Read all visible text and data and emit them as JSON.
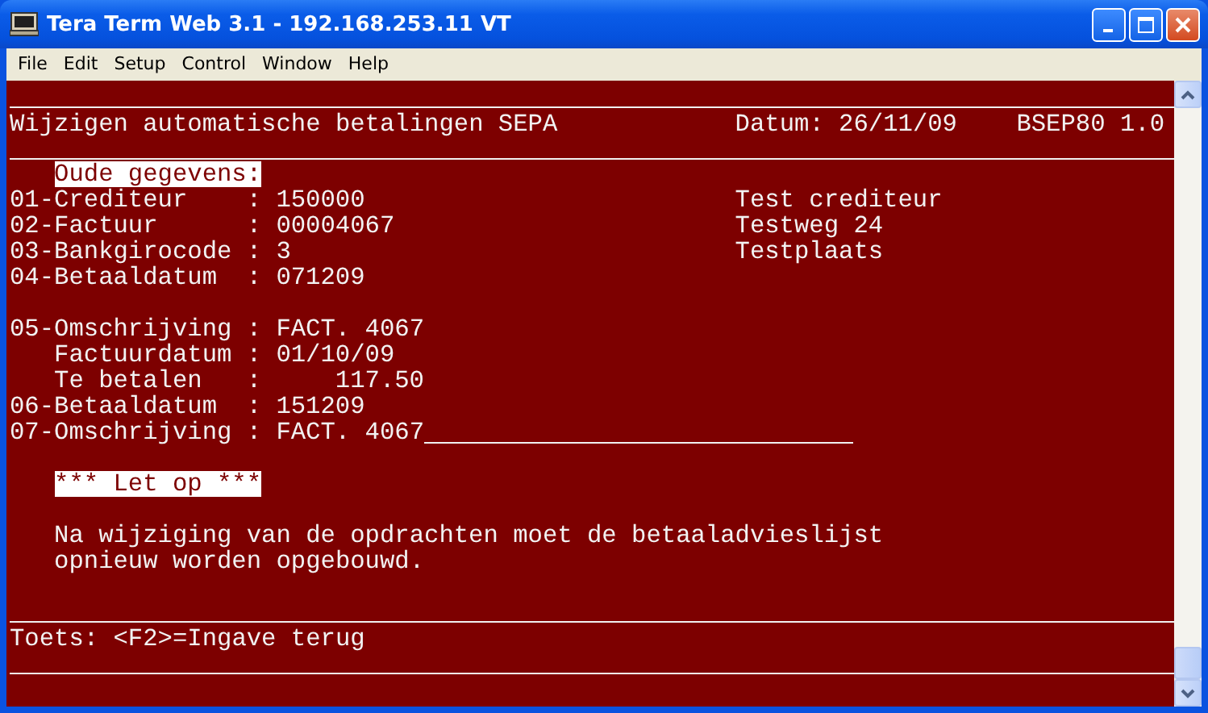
{
  "window": {
    "title": "Tera Term Web 3.1 - 192.168.253.11 VT"
  },
  "menu": [
    {
      "label": "File"
    },
    {
      "label": "Edit"
    },
    {
      "label": "Setup"
    },
    {
      "label": "Control"
    },
    {
      "label": "Window"
    },
    {
      "label": "Help"
    }
  ],
  "header": {
    "title": "Wijzigen automatische betalingen SEPA",
    "date": "Datum: 26/11/09",
    "program": "BSEP80 1.0"
  },
  "section_label": "Oude gegevens:",
  "groups": [
    {
      "fields": [
        {
          "kind": "field",
          "label": "01-Crediteur",
          "separator": ":",
          "value": "150000",
          "note": "Test crediteur"
        },
        {
          "kind": "field",
          "label": "02-Factuur",
          "separator": ":",
          "value": "00004067",
          "note": "Testweg 24"
        },
        {
          "kind": "field",
          "label": "03-Bankgirocode",
          "separator": ":",
          "value": "3",
          "note": "Testplaats"
        },
        {
          "kind": "field",
          "label": "04-Betaaldatum",
          "separator": ":",
          "value": "071209"
        }
      ]
    },
    {
      "fields": [
        {
          "kind": "field",
          "label": "05-Omschrijving",
          "separator": ":",
          "value": "FACT. 4067"
        },
        {
          "kind": "subfield",
          "label": "Factuurdatum",
          "separator": ":",
          "value": "01/10/09"
        },
        {
          "kind": "amount",
          "label": "Te betalen",
          "separator": ":",
          "value": "117.50"
        },
        {
          "kind": "field",
          "label": "06-Betaaldatum",
          "separator": ":",
          "value": "151209"
        },
        {
          "kind": "input",
          "label": "07-Omschrijving",
          "separator": ":",
          "value": "FACT. 4067"
        }
      ]
    }
  ],
  "warning": "*** Let op ***",
  "message": "Na wijziging van de opdrachten moet de betaaladvieslijst opnieuw worden opgebouwd.",
  "function_keys": "Toets: <F2>=Ingave terug"
}
